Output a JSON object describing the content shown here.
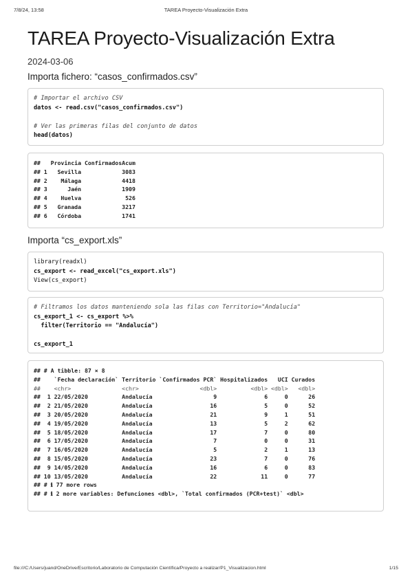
{
  "header": {
    "date": "7/8/24, 13:58",
    "title": "TAREA Proyecto-Visualización Extra"
  },
  "doc": {
    "title": "TAREA Proyecto-Visualización Extra",
    "date": "2024-03-06"
  },
  "sections": {
    "csv": "Importa fichero: “casos_confirmados.csv”",
    "xls": "Importa “cs_export.xls”"
  },
  "code1": {
    "line1": "# Importar el archivo CSV",
    "line2": "datos <- read.csv(\"casos_confirmados.csv\")",
    "line3": "# Ver las primeras filas del conjunto de datos",
    "line4": "head(datos)"
  },
  "out1": {
    "header": "##   Provincia ConfirmadosAcum",
    "rows": [
      "## 1   Sevilla            3083",
      "## 2    Málaga            4418",
      "## 3      Jaén            1909",
      "## 4    Huelva             526",
      "## 5   Granada            3217",
      "## 6   Córdoba            1741"
    ]
  },
  "code2": {
    "line1": "library(readxl)",
    "line2": "cs_export <- read_excel(\"cs_export.xls\")",
    "line3": "View(cs_export)"
  },
  "code3": {
    "line1": "# Filtramos los datos manteniendo sola las filas con Territorio=\"Andalucía\"",
    "line2": "cs_export_1 <- cs_export %>%",
    "line3": "  filter(Territorio == \"Andalucía\")",
    "line4": "cs_export_1"
  },
  "out2": {
    "lines": [
      "## # A tibble: 87 × 8",
      "##    `Fecha declaración` Territorio `Confirmados PCR` Hospitalizados   UCI Curados",
      "##    <chr>               <chr>                  <dbl>          <dbl> <dbl>   <dbl>",
      "##  1 22/05/2020          Andalucía                  9              6     0      26",
      "##  2 21/05/2020          Andalucía                 16              5     0      52",
      "##  3 20/05/2020          Andalucía                 21              9     1      51",
      "##  4 19/05/2020          Andalucía                 13              5     2      62",
      "##  5 18/05/2020          Andalucía                 17              7     0      80",
      "##  6 17/05/2020          Andalucía                  7              0     0      31",
      "##  7 16/05/2020          Andalucía                  5              2     1      13",
      "##  8 15/05/2020          Andalucía                 23              7     0      76",
      "##  9 14/05/2020          Andalucía                 16              6     0      83",
      "## 10 13/05/2020          Andalucía                 22             11     0      77",
      "## # ℹ 77 more rows",
      "## # ℹ 2 more variables: Defunciones <dbl>, `Total confirmados (PCR+test)` <dbl>"
    ]
  },
  "footer": {
    "path": "file:///C:/Users/juand/OneDrive/Escritorio/Laboratorio de Computación Científica/Proyecto a realizar/P1_Visualizacion.html",
    "page": "1/15"
  }
}
